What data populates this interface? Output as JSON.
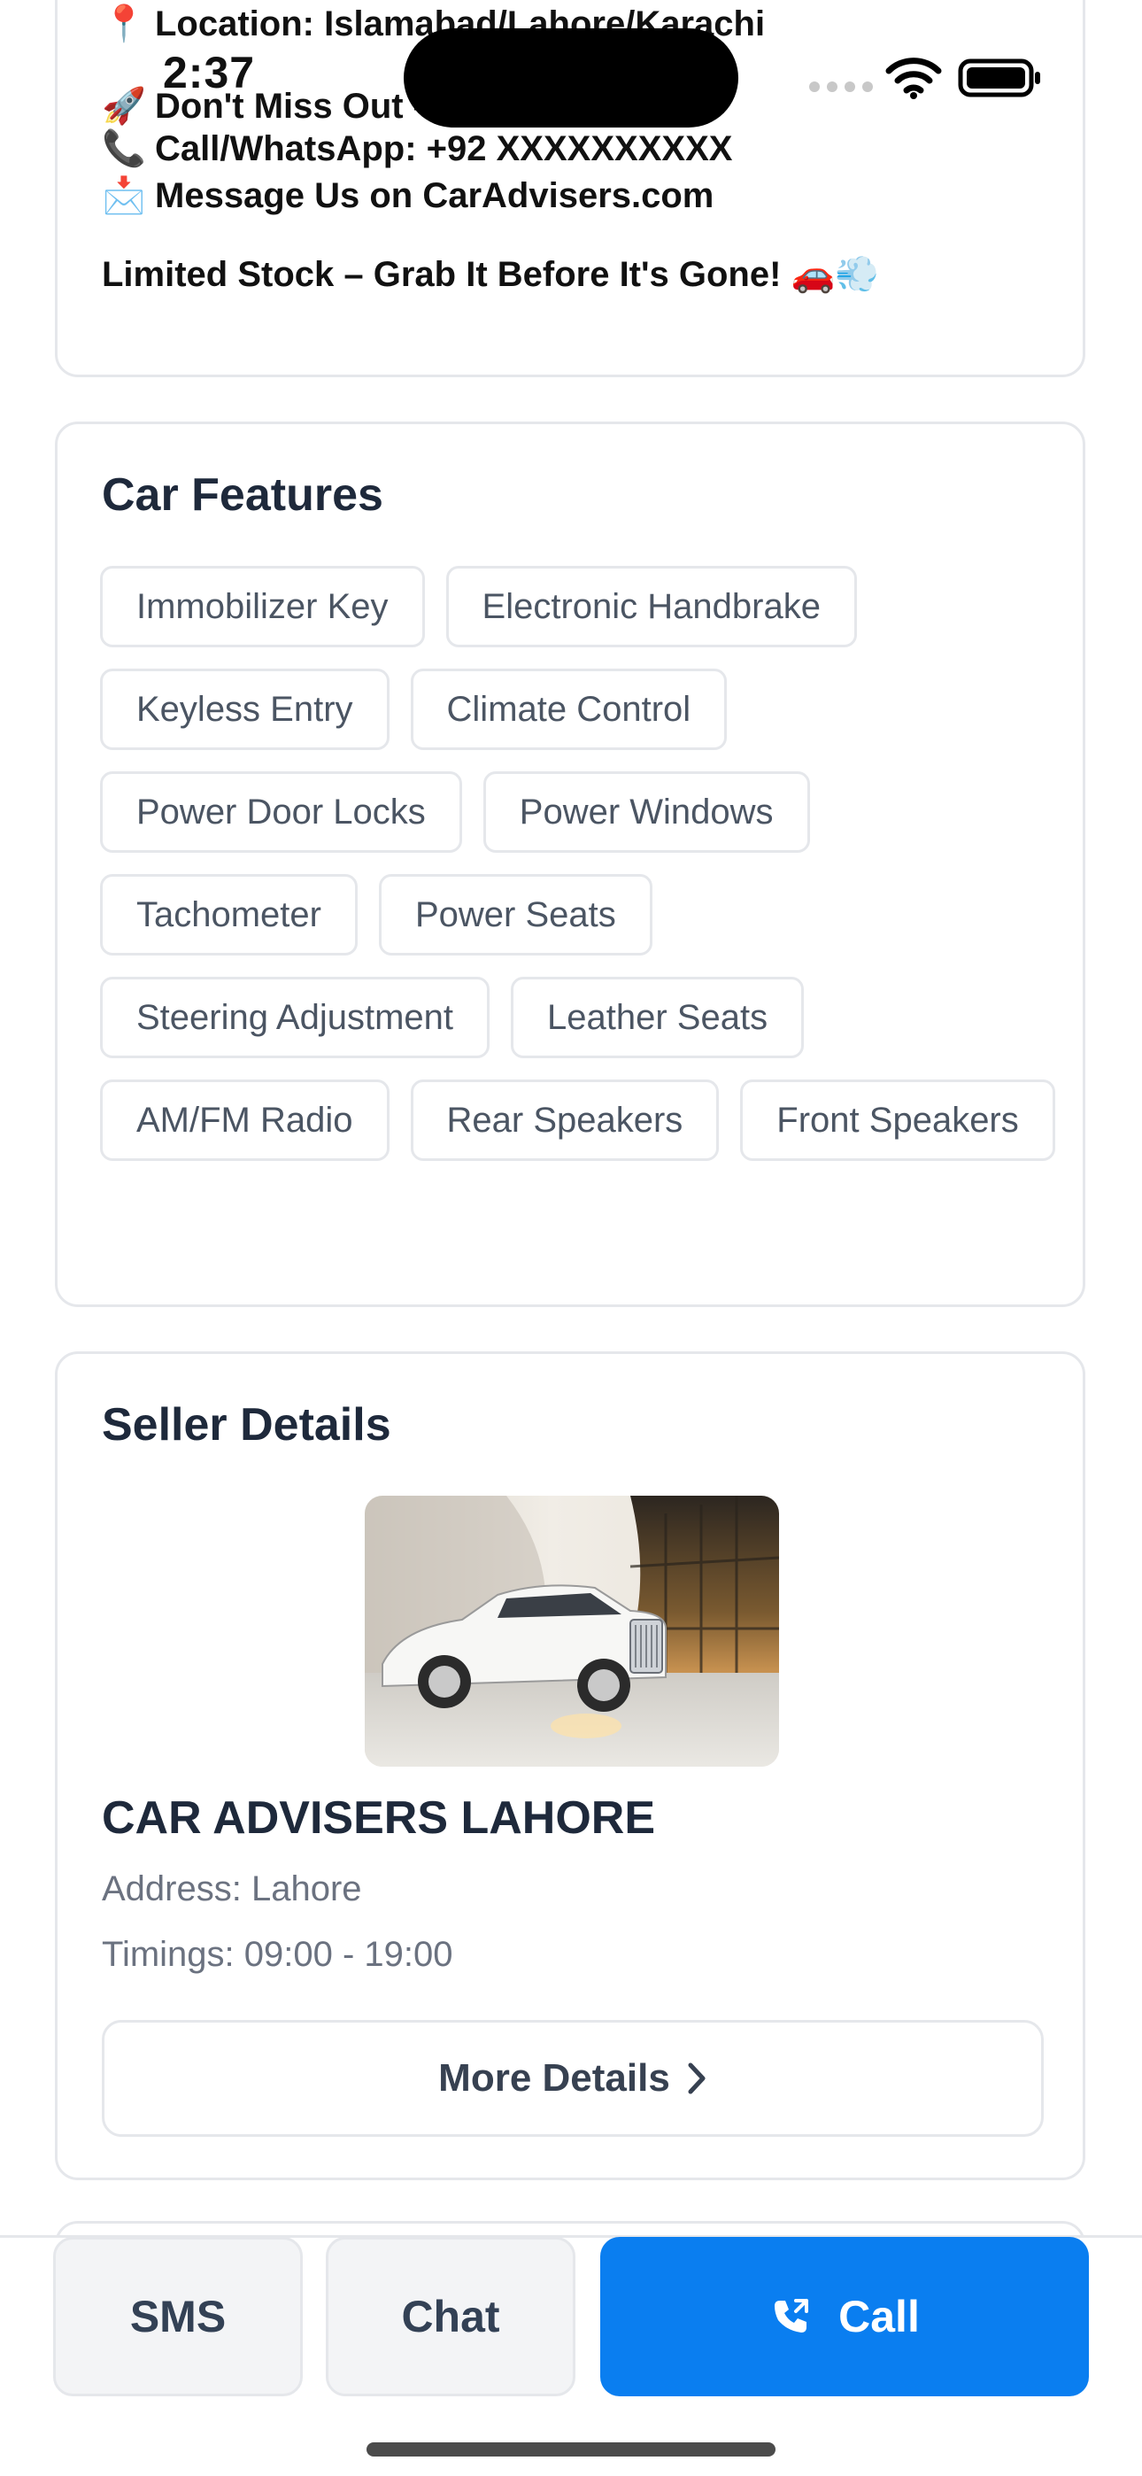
{
  "status_bar": {
    "time": "2:37"
  },
  "promo": {
    "location": {
      "emoji": "📍",
      "text": "Location: Islamabad/Lahore/Karachi"
    },
    "dont_miss": {
      "emoji": "🚀",
      "text": "Don't Miss Out – Reserve Today!"
    },
    "call": {
      "emoji": "📞",
      "text": "Call/WhatsApp: +92 XXXXXXXXXX"
    },
    "message": {
      "emoji": "📩",
      "text": "Message Us on CarAdvisers.com"
    },
    "limited": "Limited Stock – Grab It Before It's Gone! 🚗💨"
  },
  "features": {
    "title": "Car Features",
    "items": [
      "Immobilizer Key",
      "Electronic Handbrake",
      "Keyless Entry",
      "Climate Control",
      "Power Door Locks",
      "Power Windows",
      "Tachometer",
      "Power Seats",
      "Steering Adjustment",
      "Leather Seats",
      "AM/FM Radio",
      "Rear Speakers",
      "Front Speakers"
    ]
  },
  "seller": {
    "title": "Seller Details",
    "name": "CAR ADVISERS LAHORE",
    "address": "Address: Lahore",
    "timings": "Timings: 09:00 - 19:00",
    "more_details_label": "More Details"
  },
  "bottom_bar": {
    "sms_label": "SMS",
    "chat_label": "Chat",
    "call_label": "Call",
    "call_color": "#0a7ef0"
  }
}
